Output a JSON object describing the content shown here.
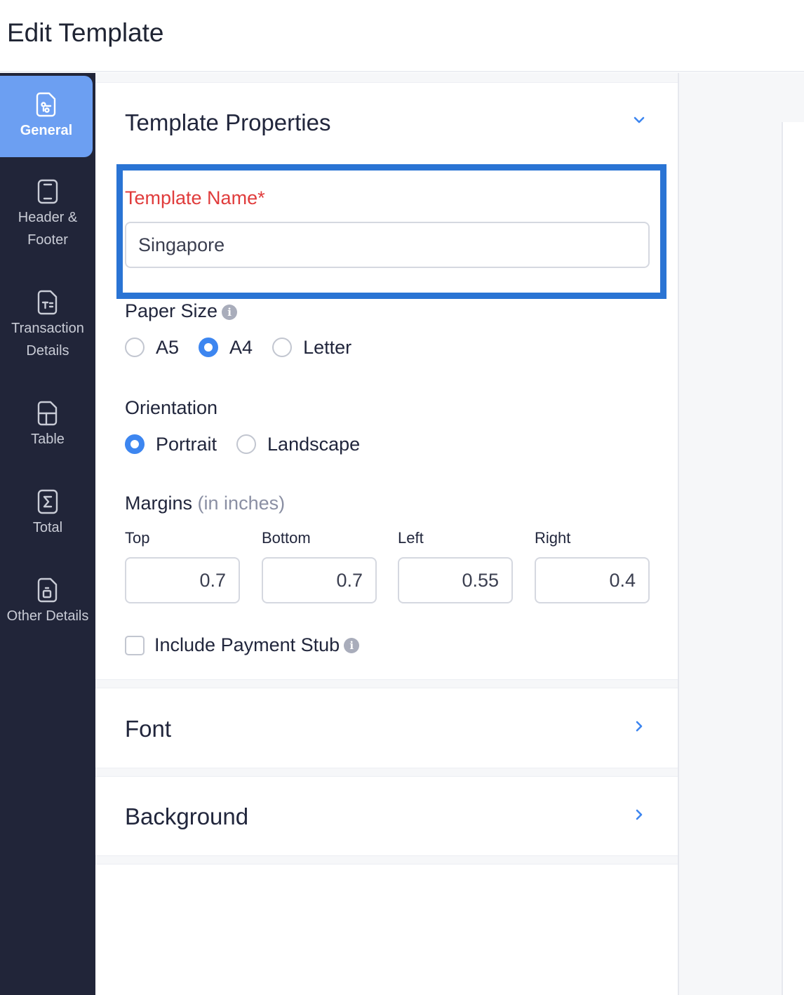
{
  "header": {
    "title": "Edit Template"
  },
  "sidebar": {
    "items": [
      {
        "label": "General",
        "icon": "general-doc-icon",
        "active": true
      },
      {
        "label_line1": "Header &",
        "label_line2": "Footer",
        "icon": "header-footer-icon"
      },
      {
        "label_line1": "Transaction",
        "label_line2": "Details",
        "icon": "transaction-details-icon"
      },
      {
        "label": "Table",
        "icon": "table-icon"
      },
      {
        "label": "Total",
        "icon": "sigma-icon"
      },
      {
        "label": "Other Details",
        "icon": "other-details-icon"
      }
    ]
  },
  "template_properties": {
    "title": "Template Properties",
    "template_name": {
      "label": "Template Name*",
      "value": "Singapore"
    },
    "paper_size": {
      "label": "Paper Size",
      "options": [
        "A5",
        "A4",
        "Letter"
      ],
      "selected": "A4"
    },
    "orientation": {
      "label": "Orientation",
      "options": [
        "Portrait",
        "Landscape"
      ],
      "selected": "Portrait"
    },
    "margins": {
      "label": "Margins",
      "unit": "(in inches)",
      "fields": [
        {
          "label": "Top",
          "value": "0.7"
        },
        {
          "label": "Bottom",
          "value": "0.7"
        },
        {
          "label": "Left",
          "value": "0.55"
        },
        {
          "label": "Right",
          "value": "0.4"
        }
      ]
    },
    "payment_stub": {
      "label": "Include Payment Stub",
      "checked": false
    }
  },
  "sections": {
    "font": {
      "title": "Font"
    },
    "background": {
      "title": "Background"
    }
  },
  "colors": {
    "accent": "#3d86f0",
    "highlight_border": "#2a74d4",
    "sidebar_bg": "#212539",
    "sidebar_active": "#6c9ff2",
    "required_label": "#e03c3c"
  }
}
